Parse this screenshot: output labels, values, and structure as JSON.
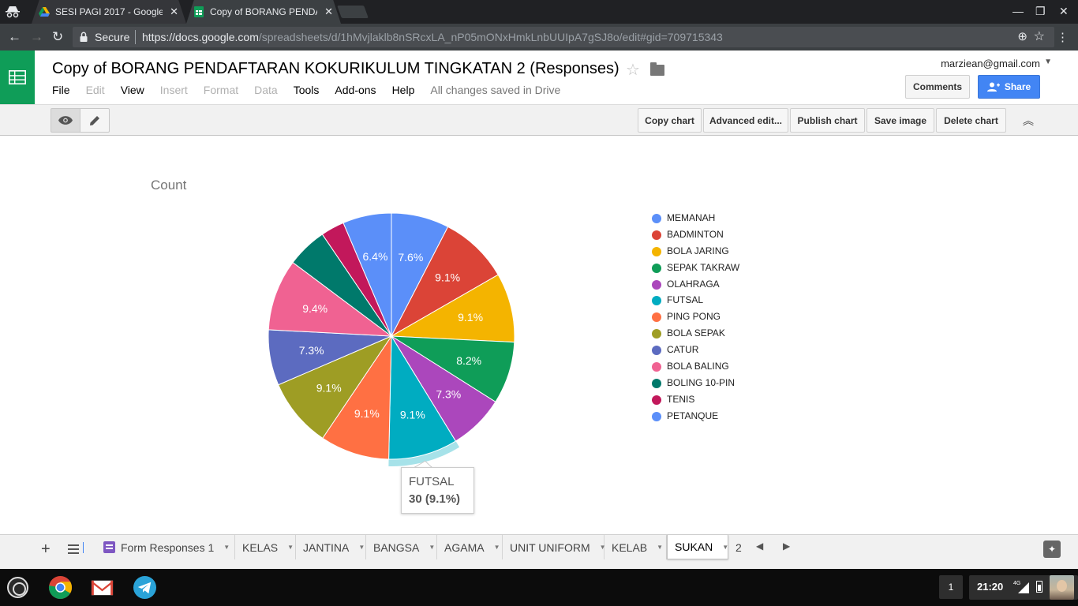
{
  "browser": {
    "tabs": [
      {
        "title": "SESI PAGI 2017 - Google",
        "active": false
      },
      {
        "title": "Copy of BORANG PENDA",
        "active": true
      }
    ],
    "omnibox": {
      "secure_label": "Secure",
      "url_host": "https://docs.google.com",
      "url_path": "/spreadsheets/d/1hMvjlaklb8nSRcxLA_nP05mONxHmkLnbUUIpA7gSJ8o/edit#gid=709715343"
    }
  },
  "doc": {
    "title": "Copy of BORANG PENDAFTARAN KOKURIKULUM TINGKATAN 2 (Responses)",
    "menu": [
      {
        "label": "File",
        "enabled": true
      },
      {
        "label": "Edit",
        "enabled": false
      },
      {
        "label": "View",
        "enabled": true
      },
      {
        "label": "Insert",
        "enabled": false
      },
      {
        "label": "Format",
        "enabled": false
      },
      {
        "label": "Data",
        "enabled": false
      },
      {
        "label": "Tools",
        "enabled": true
      },
      {
        "label": "Add-ons",
        "enabled": true
      },
      {
        "label": "Help",
        "enabled": true
      }
    ],
    "save_status": "All changes saved in Drive",
    "account": "marziean@gmail.com",
    "comments_label": "Comments",
    "share_label": "Share"
  },
  "chart_toolbar": {
    "buttons": [
      "Copy chart",
      "Advanced edit...",
      "Publish chart",
      "Save image",
      "Delete chart"
    ]
  },
  "chart_data": {
    "type": "pie",
    "title": "Count",
    "legend_position": "right",
    "slices": [
      {
        "label": "MEMANAH",
        "percent": 7.6,
        "color": "#5b8ff9"
      },
      {
        "label": "BADMINTON",
        "percent": 9.1,
        "color": "#db4437"
      },
      {
        "label": "BOLA JARING",
        "percent": 9.1,
        "color": "#f4b400"
      },
      {
        "label": "SEPAK TAKRAW",
        "percent": 8.2,
        "color": "#0f9d58"
      },
      {
        "label": "OLAHRAGA",
        "percent": 7.3,
        "color": "#ab47bc"
      },
      {
        "label": "FUTSAL",
        "percent": 9.1,
        "color": "#00acc1"
      },
      {
        "label": "PING PONG",
        "percent": 9.1,
        "color": "#ff7043"
      },
      {
        "label": "BOLA SEPAK",
        "percent": 9.1,
        "color": "#9e9d24"
      },
      {
        "label": "CATUR",
        "percent": 7.3,
        "color": "#5c6bc0"
      },
      {
        "label": "BOLA BALING",
        "percent": 9.4,
        "color": "#f06292"
      },
      {
        "label": "BOLING 10-PIN",
        "percent": 5.3,
        "color": "#00796b"
      },
      {
        "label": "TENIS",
        "percent": 3.1,
        "color": "#c2185b"
      },
      {
        "label": "PETANQUE",
        "percent": 6.4,
        "color": "#5b8ff9"
      }
    ],
    "highlighted_slice": 5,
    "tooltip": {
      "label": "FUTSAL",
      "value_text": "30 (9.1%)"
    }
  },
  "sheets": {
    "tabs": [
      "Form Responses 1",
      "KELAS",
      "JANTINA",
      "BANGSA",
      "AGAMA",
      "UNIT UNIFORM",
      "KELAB",
      "SUKAN",
      "2"
    ],
    "active": "SUKAN"
  },
  "shelf": {
    "notification_count": "1",
    "time": "21:20",
    "network": "4G"
  }
}
